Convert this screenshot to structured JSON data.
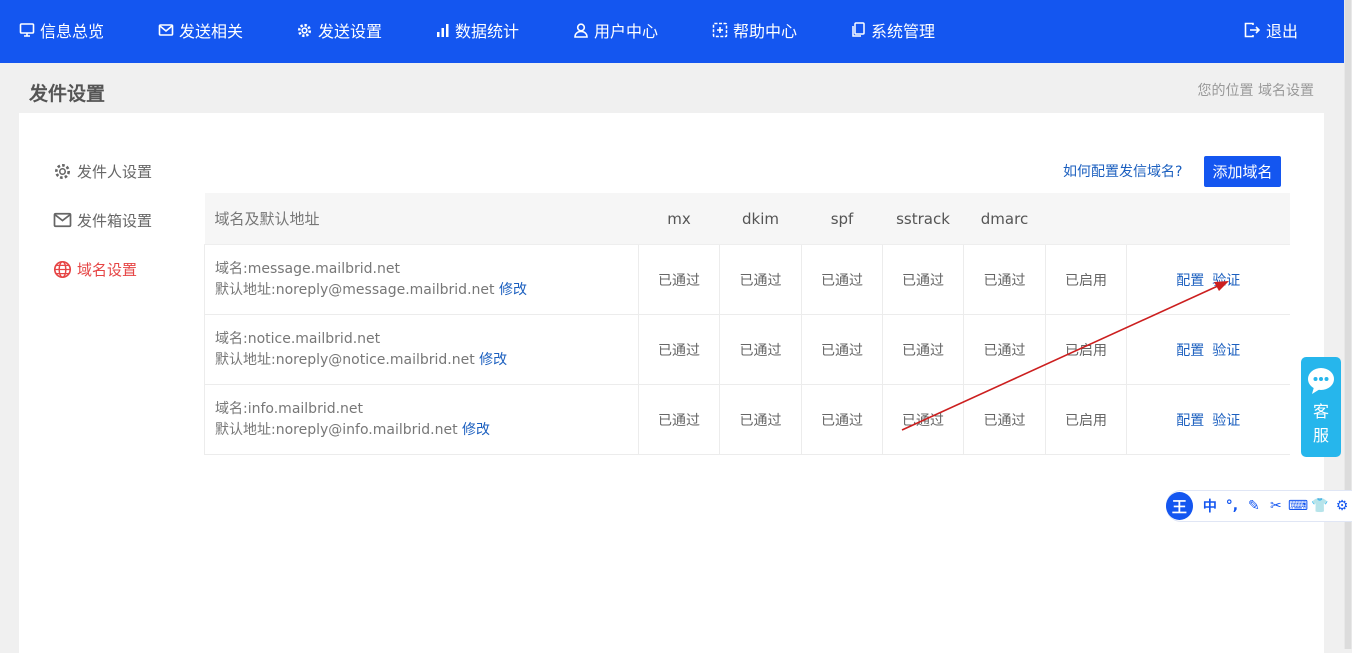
{
  "nav": {
    "items": [
      {
        "label": "信息总览",
        "icon": "monitor-icon"
      },
      {
        "label": "发送相关",
        "icon": "mail-icon"
      },
      {
        "label": "发送设置",
        "icon": "gear-icon"
      },
      {
        "label": "数据统计",
        "icon": "bar-chart-icon"
      },
      {
        "label": "用户中心",
        "icon": "user-icon"
      },
      {
        "label": "帮助中心",
        "icon": "help-box-icon"
      },
      {
        "label": "系统管理",
        "icon": "copy-icon"
      }
    ],
    "logout": {
      "label": "退出",
      "icon": "logout-icon"
    }
  },
  "page": {
    "title": "发件设置",
    "breadcrumb": "您的位置 域名设置"
  },
  "sidebar": {
    "items": [
      {
        "label": "发件人设置",
        "icon": "gear-icon",
        "active": false
      },
      {
        "label": "发件箱设置",
        "icon": "mail-icon",
        "active": false
      },
      {
        "label": "域名设置",
        "icon": "globe-icon",
        "active": true
      }
    ]
  },
  "toolbar": {
    "help_link": "如何配置发信域名?",
    "add_button": "添加域名"
  },
  "table": {
    "headers": [
      "域名及默认地址",
      "mx",
      "dkim",
      "spf",
      "sstrack",
      "dmarc",
      "",
      ""
    ],
    "domain_prefix": "域名:",
    "address_prefix": "默认地址:",
    "edit_label": "修改",
    "config_label": "配置",
    "verify_label": "验证",
    "rows": [
      {
        "domain": "message.mailbrid.net",
        "address": "noreply@message.mailbrid.net",
        "mx": "已通过",
        "dkim": "已通过",
        "spf": "已通过",
        "sstrack": "已通过",
        "dmarc": "已通过",
        "status": "已启用"
      },
      {
        "domain": "notice.mailbrid.net",
        "address": "noreply@notice.mailbrid.net",
        "mx": "已通过",
        "dkim": "已通过",
        "spf": "已通过",
        "sstrack": "已通过",
        "dmarc": "已通过",
        "status": "已启用"
      },
      {
        "domain": "info.mailbrid.net",
        "address": "noreply@info.mailbrid.net",
        "mx": "已通过",
        "dkim": "已通过",
        "spf": "已通过",
        "sstrack": "已通过",
        "dmarc": "已通过",
        "status": "已启用"
      }
    ]
  },
  "customer_service": {
    "line1": "客",
    "line2": "服",
    "icon": "chat-bubble-icon"
  },
  "ime": {
    "logo": "王",
    "tools": [
      "中",
      "°,",
      "✎",
      "✂",
      "⌨",
      "👕",
      "⚙"
    ]
  },
  "colors": {
    "nav_bg": "#1456f0",
    "link": "#1b5fbf",
    "active": "#e64545",
    "arrow": "#cc1f1f",
    "service": "#26b6ec"
  }
}
